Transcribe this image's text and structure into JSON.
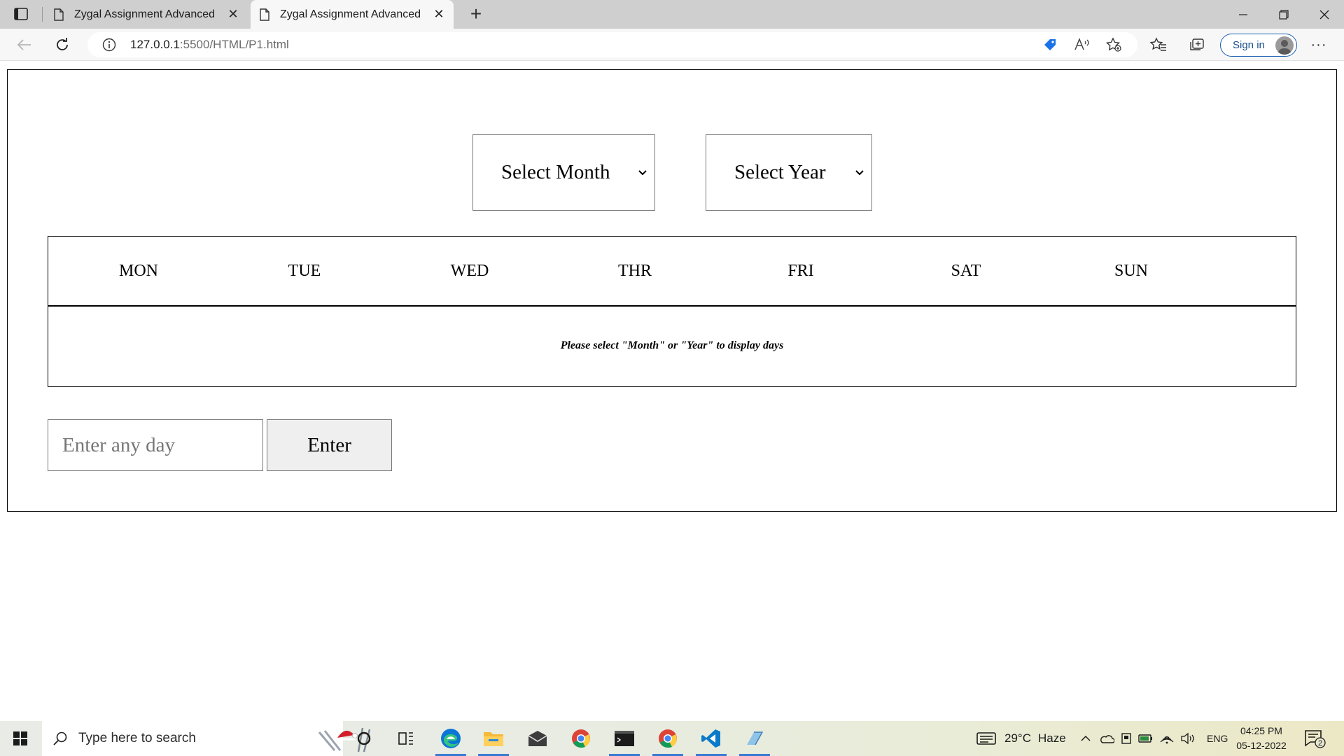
{
  "browser": {
    "tabs": [
      {
        "title": "Zygal Assignment Advanced",
        "active": false
      },
      {
        "title": "Zygal Assignment Advanced",
        "active": true
      }
    ],
    "url_host": "127.0.0.1",
    "url_rest": ":5500/HTML/P1.html",
    "sign_in_label": "Sign in"
  },
  "page": {
    "month_select": {
      "selected": "Select Month"
    },
    "year_select": {
      "selected": "Select Year"
    },
    "weekdays": [
      "MON",
      "TUE",
      "WED",
      "THR",
      "FRI",
      "SAT",
      "SUN"
    ],
    "message": "Please select \"Month\" or \"Year\" to display days",
    "day_input": {
      "placeholder": "Enter any day",
      "value": ""
    },
    "enter_button": "Enter"
  },
  "taskbar": {
    "search_placeholder": "Type here to search",
    "weather_temp": "29°C",
    "weather_desc": "Haze",
    "language": "ENG",
    "time": "04:25 PM",
    "date": "05-12-2022",
    "notification_count": "2"
  },
  "colors": {
    "accent_blue": "#1a5fb4",
    "edge_blue": "#0c76d6",
    "tab_bar": "#cfcfcf",
    "button_gray": "#efefef"
  }
}
